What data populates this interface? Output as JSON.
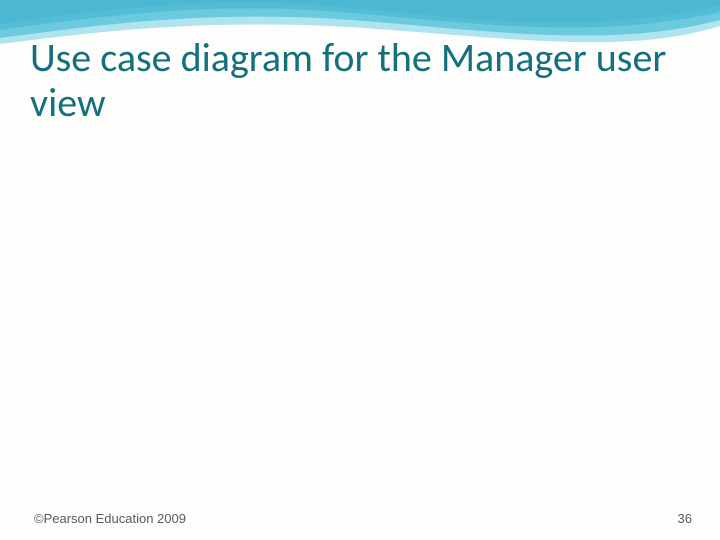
{
  "slide": {
    "title": "Use case diagram for the Manager user view",
    "footer_copyright": "©Pearson Education 2009",
    "page_number": "36"
  },
  "theme": {
    "title_color": "#14707c",
    "wave_primary": "#2aa9c9",
    "wave_mid": "#117da1",
    "wave_dark": "#0b4b66",
    "background": "#fdfdfb"
  }
}
